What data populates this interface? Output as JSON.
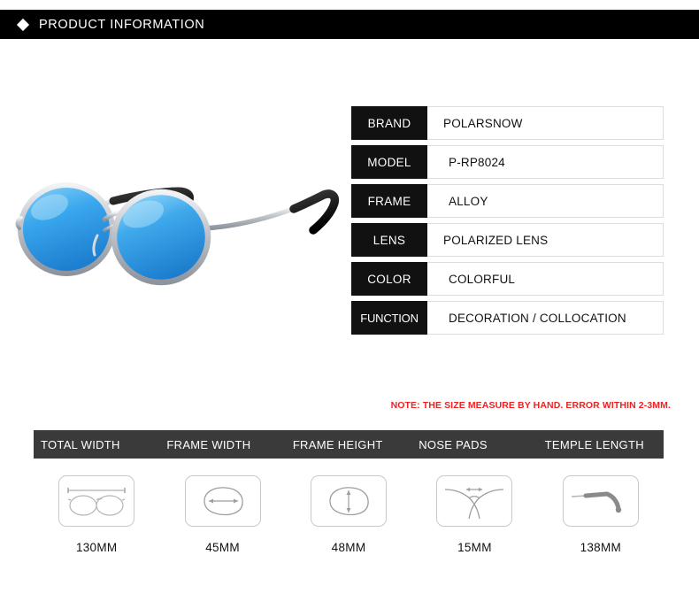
{
  "header": {
    "bullet_icon": "diamond-icon",
    "title": "PRODUCT INFORMATION"
  },
  "product_image": {
    "alt": "round blue mirrored polarized sunglasses with silver alloy frame and black temple tips",
    "lens_color": "#3aa7ee",
    "lens_color_light": "#8fd4f7",
    "frame_color": "#c9ccd1",
    "tip_color": "#1a1a1a"
  },
  "spec_table": {
    "rows": [
      {
        "label": "BRAND",
        "value": "POLARSNOW"
      },
      {
        "label": "MODEL",
        "value": "P-RP8024"
      },
      {
        "label": "FRAME",
        "value": "ALLOY"
      },
      {
        "label": "LENS",
        "value": "POLARIZED LENS"
      },
      {
        "label": "COLOR",
        "value": "COLORFUL"
      },
      {
        "label": "FUNCTION",
        "value": "DECORATION / COLLOCATION"
      }
    ]
  },
  "size_note": {
    "text": "NOTE: THE SIZE MEASURE BY HAND. ERROR WITHIN 2-3MM.",
    "color": "#ee2222"
  },
  "measurements": {
    "header_color": "#3a3a3a",
    "columns": [
      {
        "header": "TOTAL WIDTH",
        "value": "130MM",
        "icon": "glasses-total-width-icon"
      },
      {
        "header": "FRAME WIDTH",
        "value": "45MM",
        "icon": "lens-width-arrow-icon"
      },
      {
        "header": "FRAME HEIGHT",
        "value": "48MM",
        "icon": "lens-height-arrow-icon"
      },
      {
        "header": "NOSE PADS",
        "value": "15MM",
        "icon": "nose-bridge-arrow-icon"
      },
      {
        "header": "TEMPLE LENGTH",
        "value": "138MM",
        "icon": "temple-arm-icon"
      }
    ]
  }
}
